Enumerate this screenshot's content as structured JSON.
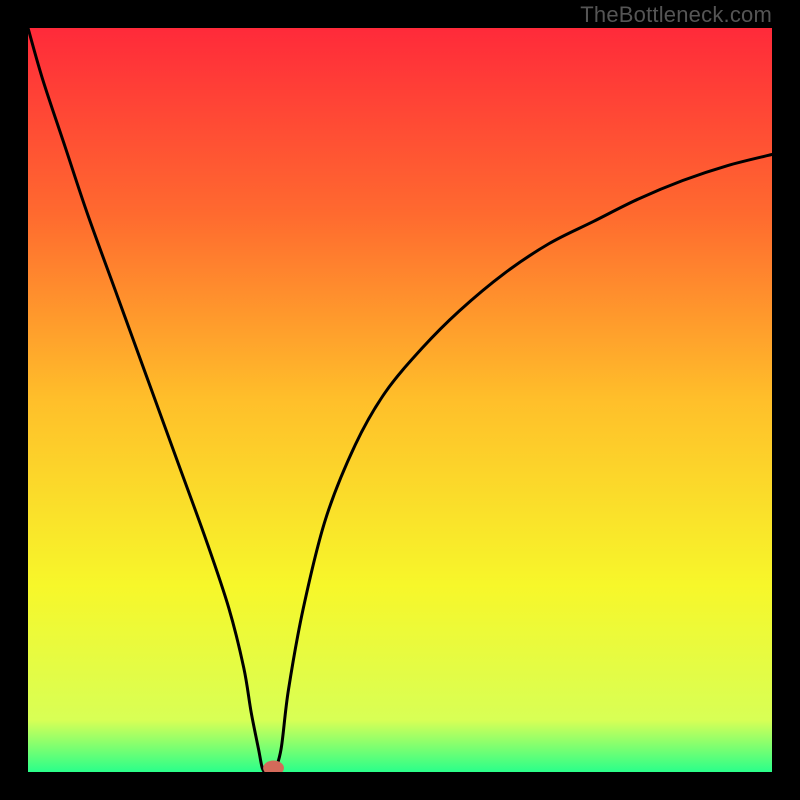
{
  "watermark": "TheBottleneck.com",
  "chart_data": {
    "type": "line",
    "title": "",
    "xlabel": "",
    "ylabel": "",
    "xlim": [
      0,
      100
    ],
    "ylim": [
      0,
      100
    ],
    "grid": false,
    "legend": false,
    "annotations": [],
    "background_gradient": {
      "stops": [
        {
          "pos": 0.0,
          "color": "#ff2a3a"
        },
        {
          "pos": 0.25,
          "color": "#ff6a2f"
        },
        {
          "pos": 0.5,
          "color": "#ffbf2a"
        },
        {
          "pos": 0.75,
          "color": "#f7f72a"
        },
        {
          "pos": 0.93,
          "color": "#d8ff55"
        },
        {
          "pos": 1.0,
          "color": "#2aff8a"
        }
      ]
    },
    "series": [
      {
        "name": "curve",
        "color": "#000000",
        "x": [
          0,
          2,
          5,
          8,
          12,
          16,
          20,
          24,
          27,
          29,
          30,
          31,
          31.5,
          32,
          33,
          34,
          35,
          37,
          40,
          44,
          48,
          53,
          58,
          64,
          70,
          76,
          82,
          88,
          94,
          100
        ],
        "y": [
          100,
          93,
          84,
          75,
          64,
          53,
          42,
          31,
          22,
          14,
          8,
          3,
          0.5,
          0,
          0,
          3,
          11,
          22,
          34,
          44,
          51,
          57,
          62,
          67,
          71,
          74,
          77,
          79.5,
          81.5,
          83
        ]
      }
    ],
    "marker": {
      "x": 33.0,
      "y": 0.0,
      "color": "#d46a5a",
      "rx": 1.4,
      "ry": 1.0
    }
  }
}
